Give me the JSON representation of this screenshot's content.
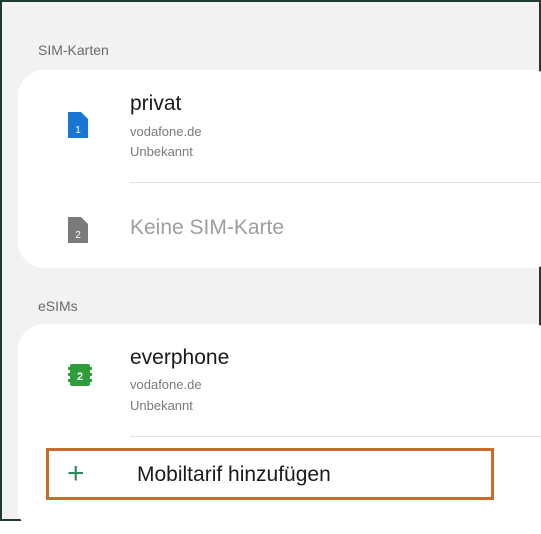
{
  "sim_section": {
    "header": "SIM-Karten",
    "cards": [
      {
        "title": "privat",
        "carrier": "vodafone.de",
        "status": "Unbekannt",
        "slot": "1",
        "color": "#1976d2"
      },
      {
        "title": "Keine SIM-Karte",
        "slot": "2",
        "color": "#7a7a7a"
      }
    ]
  },
  "esim_section": {
    "header": "eSIMs",
    "esim": {
      "title": "everphone",
      "carrier": "vodafone.de",
      "status": "Unbekannt",
      "slot": "2",
      "color": "#2e9d3a"
    },
    "add_label": "Mobiltarif hinzufügen",
    "add_icon": "plus-icon",
    "highlight_color": "#c86a2e"
  }
}
